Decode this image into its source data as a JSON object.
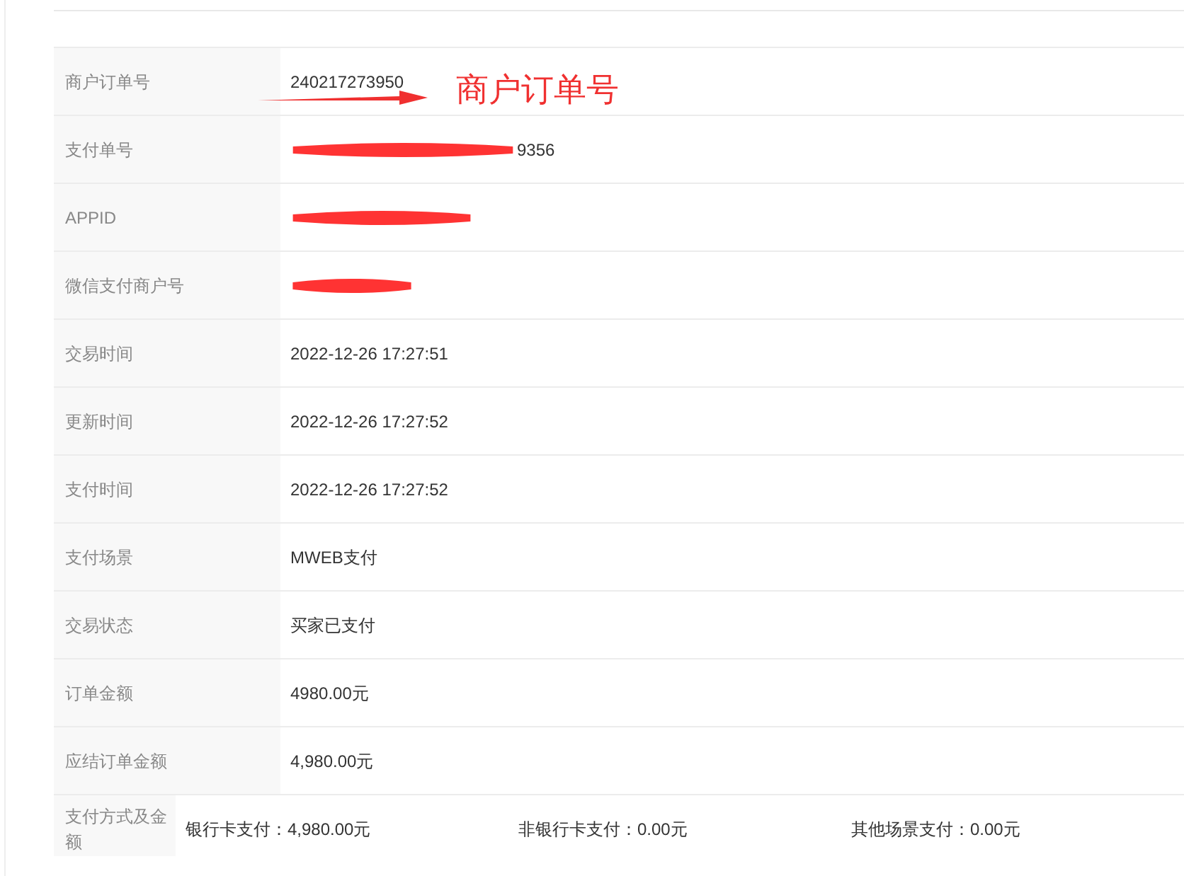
{
  "rows": [
    {
      "label": "商户订单号",
      "value": "240217273950"
    },
    {
      "label": "支付单号",
      "value": "9356",
      "redacted": true
    },
    {
      "label": "APPID",
      "redacted": true
    },
    {
      "label": "微信支付商户号",
      "redacted": true
    },
    {
      "label": "交易时间",
      "value": "2022-12-26 17:27:51"
    },
    {
      "label": "更新时间",
      "value": "2022-12-26 17:27:52"
    },
    {
      "label": "支付时间",
      "value": "2022-12-26 17:27:52"
    },
    {
      "label": "支付场景",
      "value": "MWEB支付"
    },
    {
      "label": "交易状态",
      "value": "买家已支付"
    },
    {
      "label": "订单金额",
      "value": "4980.00元"
    },
    {
      "label": "应结订单金额",
      "value": "4,980.00元"
    },
    {
      "label": "支付方式及金额",
      "parts": [
        "银行卡支付：4,980.00元",
        "非银行卡支付：0.00元",
        "其他场景支付：0.00元"
      ]
    }
  ],
  "annotation": {
    "text": "商户订单号"
  }
}
